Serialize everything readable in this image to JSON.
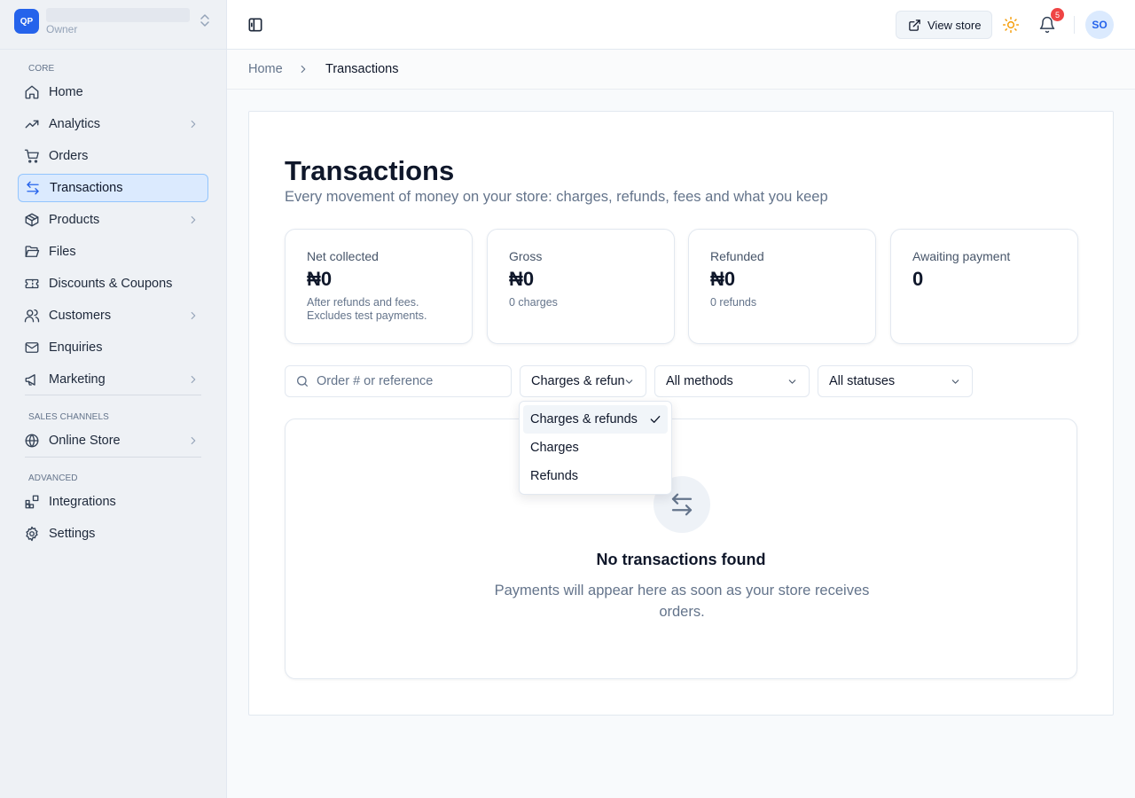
{
  "brand": {
    "logo": "QP",
    "name": "",
    "role": "Owner"
  },
  "sidebar": {
    "sections": [
      {
        "label": "CORE"
      },
      {
        "label": "SALES CHANNELS"
      },
      {
        "label": "ADVANCED"
      }
    ],
    "items": [
      {
        "label": "Home",
        "icon": "home-icon"
      },
      {
        "label": "Analytics",
        "icon": "trending-up-icon",
        "expandable": true
      },
      {
        "label": "Orders",
        "icon": "cart-icon"
      },
      {
        "label": "Transactions",
        "icon": "arrows-left-right-icon",
        "active": true
      },
      {
        "label": "Products",
        "icon": "box-icon",
        "expandable": true
      },
      {
        "label": "Files",
        "icon": "folder-icon"
      },
      {
        "label": "Discounts & Coupons",
        "icon": "ticket-icon"
      },
      {
        "label": "Customers",
        "icon": "users-icon",
        "expandable": true
      },
      {
        "label": "Enquiries",
        "icon": "mail-icon"
      },
      {
        "label": "Marketing",
        "icon": "megaphone-icon",
        "expandable": true
      },
      {
        "label": "Online Store",
        "icon": "globe-icon",
        "expandable": true
      },
      {
        "label": "Integrations",
        "icon": "blocks-icon"
      },
      {
        "label": "Settings",
        "icon": "gear-icon"
      }
    ]
  },
  "header": {
    "view_store_label": "View store",
    "notification_count": "5",
    "avatar_initials": "SO"
  },
  "breadcrumb": {
    "home": "Home",
    "current": "Transactions"
  },
  "page": {
    "title": "Transactions",
    "subtitle": "Every movement of money on your store: charges, refunds, fees and what you keep"
  },
  "stats": [
    {
      "label": "Net collected",
      "value": "₦0",
      "note": "After refunds and fees.",
      "note2": "Excludes test payments."
    },
    {
      "label": "Gross",
      "value": "₦0",
      "note": "0 charges"
    },
    {
      "label": "Refunded",
      "value": "₦0",
      "note": "0 refunds"
    },
    {
      "label": "Awaiting payment",
      "value": "0"
    }
  ],
  "filters": {
    "search_placeholder": "Order # or reference",
    "type_value": "Charges & refunds",
    "method_value": "All methods",
    "status_value": "All statuses"
  },
  "dropdown": {
    "options": [
      {
        "label": "Charges & refunds",
        "selected": true
      },
      {
        "label": "Charges"
      },
      {
        "label": "Refunds"
      }
    ]
  },
  "empty_state": {
    "title": "No transactions found",
    "description": "Payments will appear here as soon as your store receives orders."
  },
  "colors": {
    "accent": "#2563eb",
    "badge": "#ef4444",
    "sun": "#f59e0b"
  }
}
